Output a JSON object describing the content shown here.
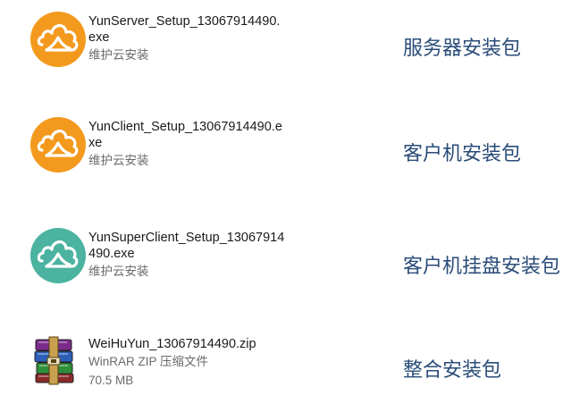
{
  "items": [
    {
      "name_line1": "YunServer_Setup_13067914490.",
      "name_line2": "exe",
      "subtitle": "维护云安装",
      "package_label": "服务器安装包",
      "icon": "cloud-app-icon",
      "icon_color": "#F39A1E"
    },
    {
      "name_line1": "YunClient_Setup_13067914490.e",
      "name_line2": "xe",
      "subtitle": "维护云安装",
      "package_label": "客户机安装包",
      "icon": "cloud-app-icon",
      "icon_color": "#F39A1E"
    },
    {
      "name_line1": "YunSuperClient_Setup_13067914",
      "name_line2": "490.exe",
      "subtitle": "维护云安装",
      "package_label": "客户机挂盘安装包",
      "icon": "cloud-app-icon",
      "icon_color": "#4BB3A0"
    },
    {
      "name_line1": "WeiHuYun_13067914490.zip",
      "subtitle": "WinRAR ZIP 压缩文件",
      "size": "70.5 MB",
      "package_label": "整合安装包",
      "icon": "winrar-archive-icon"
    }
  ]
}
